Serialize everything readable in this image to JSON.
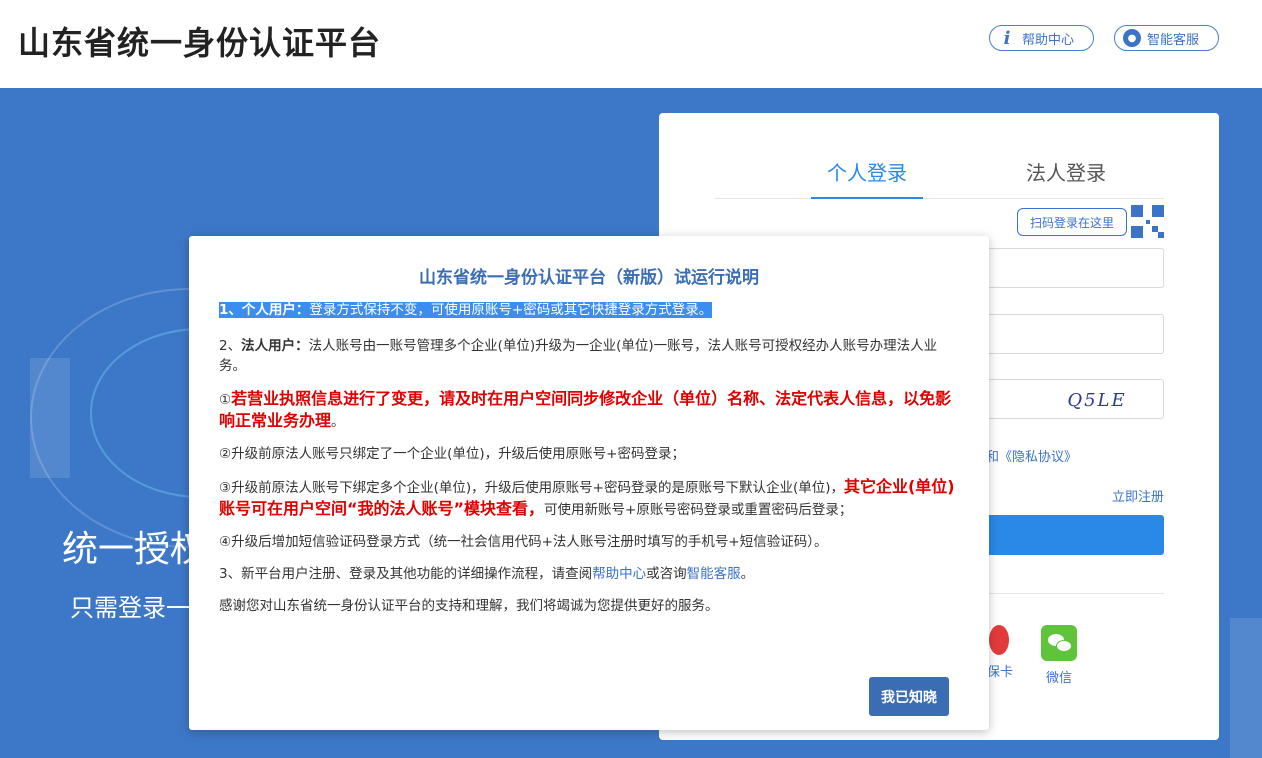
{
  "header": {
    "title": "山东省统一身份认证平台",
    "help_label": "帮助中心",
    "service_label": "智能客服"
  },
  "banner": {
    "slogan_big": "统一授权",
    "slogan_small": "只需登录一"
  },
  "login": {
    "tabs": [
      "个人登录",
      "法人登录"
    ],
    "qr_tip": "扫码登录在这里",
    "captcha_text": "Q5LE",
    "privacy_text": "和《隐私协议》",
    "register_label": "立即注册",
    "other_login": {
      "card_label": "保卡",
      "wechat_label": "微信"
    }
  },
  "modal": {
    "title": "山东省统一身份认证平台（新版）试运行说明",
    "p1_bold": "1、个人用户：",
    "p1_text": "登录方式保持不变，可使用原账号+密码或其它快捷登录方式登录。",
    "p2_prefix": "2、",
    "p2_bold": "法人用户：",
    "p2_text": "法人账号由一账号管理多个企业(单位)升级为一企业(单位)一账号，法人账号可授权经办人账号办理法人业务。",
    "p3_marker": "①",
    "p3_red": "若营业执照信息进行了变更，请及时在用户空间同步修改企业（单位）名称、法定代表人信息，以免影响正常业务办理",
    "p3_end": "。",
    "p4": "②升级前原法人账号只绑定了一个企业(单位)，升级后使用原账号+密码登录；",
    "p5_text": "③升级前原法人账号下绑定多个企业(单位)，升级后使用原账号+密码登录的是原账号下默认企业(单位)，",
    "p5_red": "其它企业(单位)账号可在用户空间“我的法人账号”模块查看，",
    "p5_end": "可使用新账号+原账号密码登录或重置密码后登录；",
    "p6": "④升级后增加短信验证码登录方式（统一社会信用代码+法人账号注册时填写的手机号+短信验证码）。",
    "p7_a": "3、新平台用户注册、登录及其他功能的详细操作流程，请查阅",
    "p7_link1": "帮助中心",
    "p7_b": "或咨询",
    "p7_link2": "智能客服",
    "p7_c": "。",
    "p8": "感谢您对山东省统一身份认证平台的支持和理解，我们将竭诚为您提供更好的服务。",
    "ok_label": "我已知晓"
  },
  "colors": {
    "banner_bg": "#3d78c8",
    "accent": "#2a88e6",
    "modal_title": "#3b6db5",
    "warning": "#e00000"
  }
}
